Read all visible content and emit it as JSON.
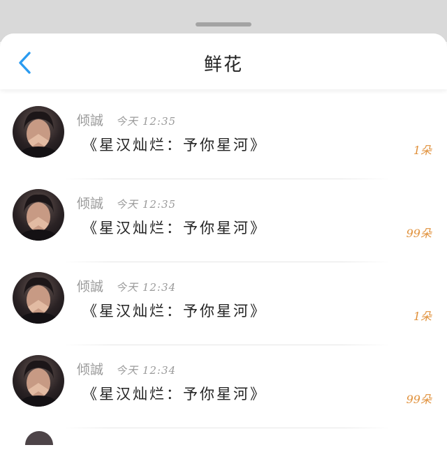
{
  "header": {
    "title": "鲜花"
  },
  "icons": {
    "back": "chevron-left-icon",
    "accent": "#2a9bf0"
  },
  "colors": {
    "count": "#e0903a",
    "meta": "#9a9a9a"
  },
  "messages": [
    {
      "sender": "倾誠",
      "day": "今天",
      "time": "12:35",
      "gift": "《星汉灿烂：予你星河》",
      "count": "1朵"
    },
    {
      "sender": "倾誠",
      "day": "今天",
      "time": "12:35",
      "gift": "《星汉灿烂：予你星河》",
      "count": "99朵"
    },
    {
      "sender": "倾誠",
      "day": "今天",
      "time": "12:34",
      "gift": "《星汉灿烂：予你星河》",
      "count": "1朵"
    },
    {
      "sender": "倾誠",
      "day": "今天",
      "time": "12:34",
      "gift": "《星汉灿烂：予你星河》",
      "count": "99朵"
    }
  ]
}
